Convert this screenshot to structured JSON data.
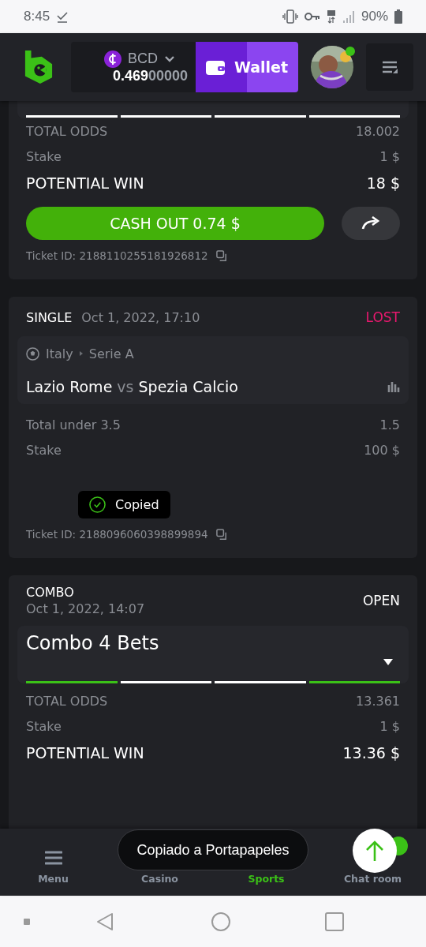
{
  "status_bar": {
    "time": "8:45",
    "battery": "90%"
  },
  "header": {
    "currency": "BCD",
    "balance_main": "0.469",
    "balance_rest": "00000",
    "wallet_button": "Wallet",
    "avatar": {
      "kind": "picture",
      "online": true
    }
  },
  "bets": [
    {
      "kind": "combo_tail",
      "legs": [
        {
          "won": false
        },
        {
          "won": false
        },
        {
          "won": false
        },
        {
          "won": false
        }
      ],
      "total_odds_label": "TOTAL ODDS",
      "total_odds": "18.002",
      "stake_label": "Stake",
      "stake": "1 $",
      "win_label": "POTENTIAL WIN",
      "win": "18 $",
      "cash_out": "CASH OUT 0.74 $",
      "ticket": "Ticket ID: 2188110255181926812"
    },
    {
      "kind": "single",
      "type": "SINGLE",
      "date": "Oct 1, 2022, 17:10",
      "status": "LOST",
      "lost": true,
      "country": "Italy",
      "league": "Serie A",
      "home": "Lazio Rome",
      "vs": "vs",
      "away": "Spezia Calcio",
      "market": "Total under 3.5",
      "odds": "1.5",
      "stake_label": "Stake",
      "stake": "100 $",
      "tooltip": "Copied",
      "ticket": "Ticket ID: 2188096060398899894"
    },
    {
      "kind": "combo",
      "type": "COMBO",
      "date": "Oct 1, 2022, 14:07",
      "status": "OPEN",
      "lost": false,
      "title": "Combo 4 Bets",
      "legs": [
        {
          "won": true
        },
        {
          "won": false
        },
        {
          "won": false
        },
        {
          "won": true
        }
      ],
      "total_odds_label": "TOTAL ODDS",
      "total_odds": "13.361",
      "stake_label": "Stake",
      "stake": "1 $",
      "win_label": "POTENTIAL WIN",
      "win": "13.36 $"
    }
  ],
  "bottom_nav": [
    {
      "label": "Menu",
      "selected": false
    },
    {
      "label": "Casino",
      "selected": false
    },
    {
      "label": "Sports",
      "selected": true
    },
    {
      "label": "Chat room",
      "selected": false
    }
  ],
  "toast": "Copiado a Portapapeles"
}
